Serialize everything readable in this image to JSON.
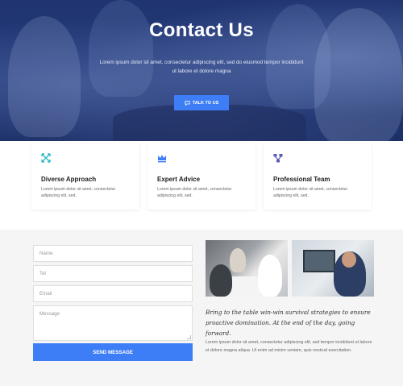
{
  "hero": {
    "title": "Contact Us",
    "text": "Lorem ipsum dolor sit amet, consectetur adipiscing elit, sed do eiusmod tempor incididunt ut labore et dolore magna",
    "button_label": "TALK TO US",
    "button_icon": "chat-icon"
  },
  "features": [
    {
      "icon": "arrows-expand-icon",
      "title": "Diverse Approach",
      "text": "Lorem ipsum dolor sit amet, consectetur adipiscing elit, sed."
    },
    {
      "icon": "crown-icon",
      "title": "Expert Advice",
      "text": "Lorem ipsum dolor sit amet, consectetur adipiscing elit, sed."
    },
    {
      "icon": "network-icon",
      "title": "Professional Team",
      "text": "Lorem ipsum dolor sit amet, consectetur adipiscing elit, sed."
    }
  ],
  "form": {
    "name_placeholder": "Name",
    "tel_placeholder": "Tel",
    "email_placeholder": "Email",
    "message_placeholder": "Message",
    "send_label": "SEND MESSAGE"
  },
  "about": {
    "quote": "Bring to the table win-win survival strategies to ensure proactive domination. At the end of the day, going forward.",
    "text": "Lorem ipsum dolor sit amet, consectetur adipiscing elit, sed tempor incididunt ut labore et dolore magna aliqua. Ut enim ad minim veniam, quis nostrud exercitation."
  },
  "colors": {
    "accent": "#3d7df5",
    "hero_overlay": "#223a7a",
    "section_bg": "#f5f5f6"
  }
}
